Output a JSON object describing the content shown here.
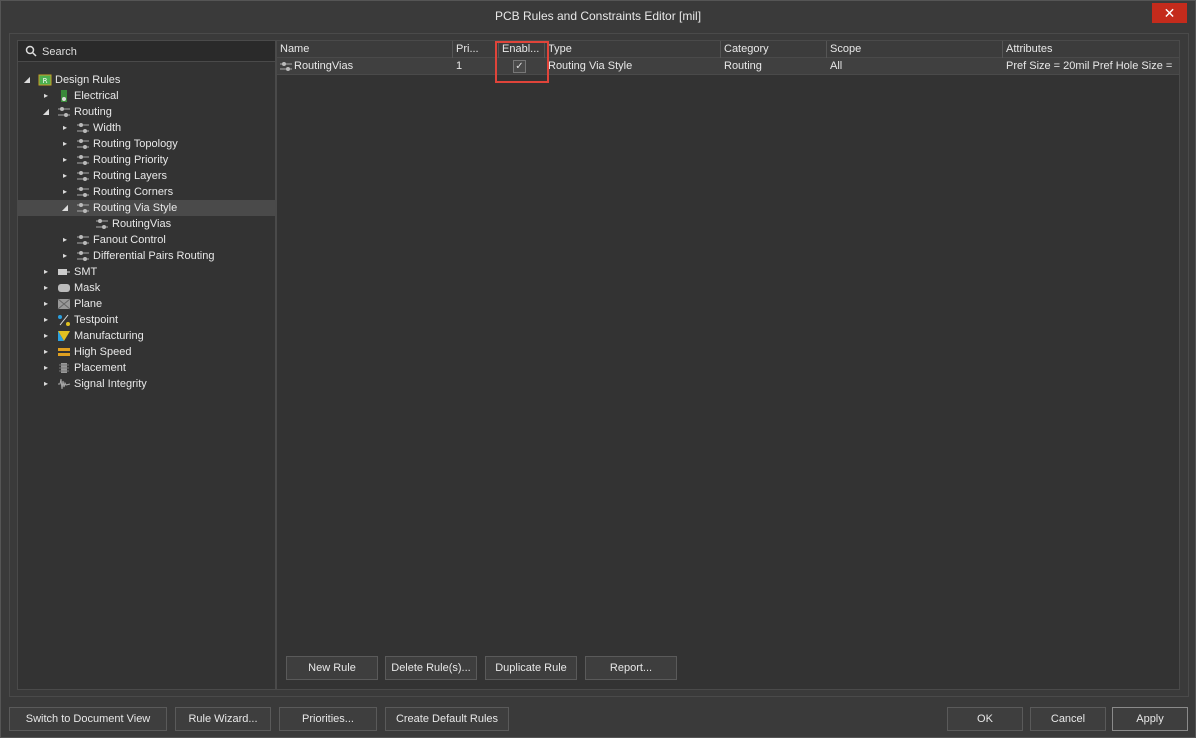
{
  "window": {
    "title": "PCB Rules and Constraints Editor [mil]",
    "close_glyph": "✕"
  },
  "search": {
    "placeholder": "Search"
  },
  "tree": [
    {
      "label": "Design Rules",
      "icon": "design-rules-icon",
      "arrow": "◢"
    },
    {
      "label": "Electrical",
      "icon": "electrical-icon",
      "arrow": "▸"
    },
    {
      "label": "Routing",
      "icon": "routing-icon",
      "arrow": "◢"
    },
    {
      "label": "Width",
      "icon": "routing-rule-icon",
      "arrow": "▸"
    },
    {
      "label": "Routing Topology",
      "icon": "routing-rule-icon",
      "arrow": "▸"
    },
    {
      "label": "Routing Priority",
      "icon": "routing-rule-icon",
      "arrow": "▸"
    },
    {
      "label": "Routing Layers",
      "icon": "routing-rule-icon",
      "arrow": "▸"
    },
    {
      "label": "Routing Corners",
      "icon": "routing-rule-icon",
      "arrow": "▸"
    },
    {
      "label": "Routing Via Style",
      "icon": "routing-rule-icon",
      "arrow": "◢"
    },
    {
      "label": "RoutingVias",
      "icon": "routing-rule-icon",
      "arrow": ""
    },
    {
      "label": "Fanout Control",
      "icon": "routing-rule-icon",
      "arrow": "▸"
    },
    {
      "label": "Differential Pairs Routing",
      "icon": "routing-rule-icon",
      "arrow": "▸"
    },
    {
      "label": "SMT",
      "icon": "smt-icon",
      "arrow": "▸"
    },
    {
      "label": "Mask",
      "icon": "mask-icon",
      "arrow": "▸"
    },
    {
      "label": "Plane",
      "icon": "plane-icon",
      "arrow": "▸"
    },
    {
      "label": "Testpoint",
      "icon": "testpoint-icon",
      "arrow": "▸"
    },
    {
      "label": "Manufacturing",
      "icon": "manufacturing-icon",
      "arrow": "▸"
    },
    {
      "label": "High Speed",
      "icon": "high-speed-icon",
      "arrow": "▸"
    },
    {
      "label": "Placement",
      "icon": "placement-icon",
      "arrow": "▸"
    },
    {
      "label": "Signal Integrity",
      "icon": "signal-integrity-icon",
      "arrow": "▸"
    }
  ],
  "grid": {
    "columns": [
      "Name",
      "Pri...",
      "Enabl...",
      "Type",
      "Category",
      "Scope",
      "Attributes"
    ],
    "rows": [
      {
        "name": "RoutingVias",
        "priority": "1",
        "enabled": "✓",
        "type": "Routing Via Style",
        "category": "Routing",
        "scope": "All",
        "attributes": "Pref Size = 20mil    Pref Hole Size ="
      }
    ]
  },
  "rule_buttons": {
    "new_rule": "New Rule",
    "delete_rules": "Delete Rule(s)...",
    "duplicate_rule": "Duplicate Rule",
    "report": "Report..."
  },
  "footer_buttons": {
    "switch_view": "Switch to Document View",
    "rule_wizard": "Rule Wizard...",
    "priorities": "Priorities...",
    "create_default": "Create Default Rules",
    "ok": "OK",
    "cancel": "Cancel",
    "apply": "Apply"
  },
  "colors": {
    "highlight": "#e0443a",
    "close": "#c42b1c"
  }
}
